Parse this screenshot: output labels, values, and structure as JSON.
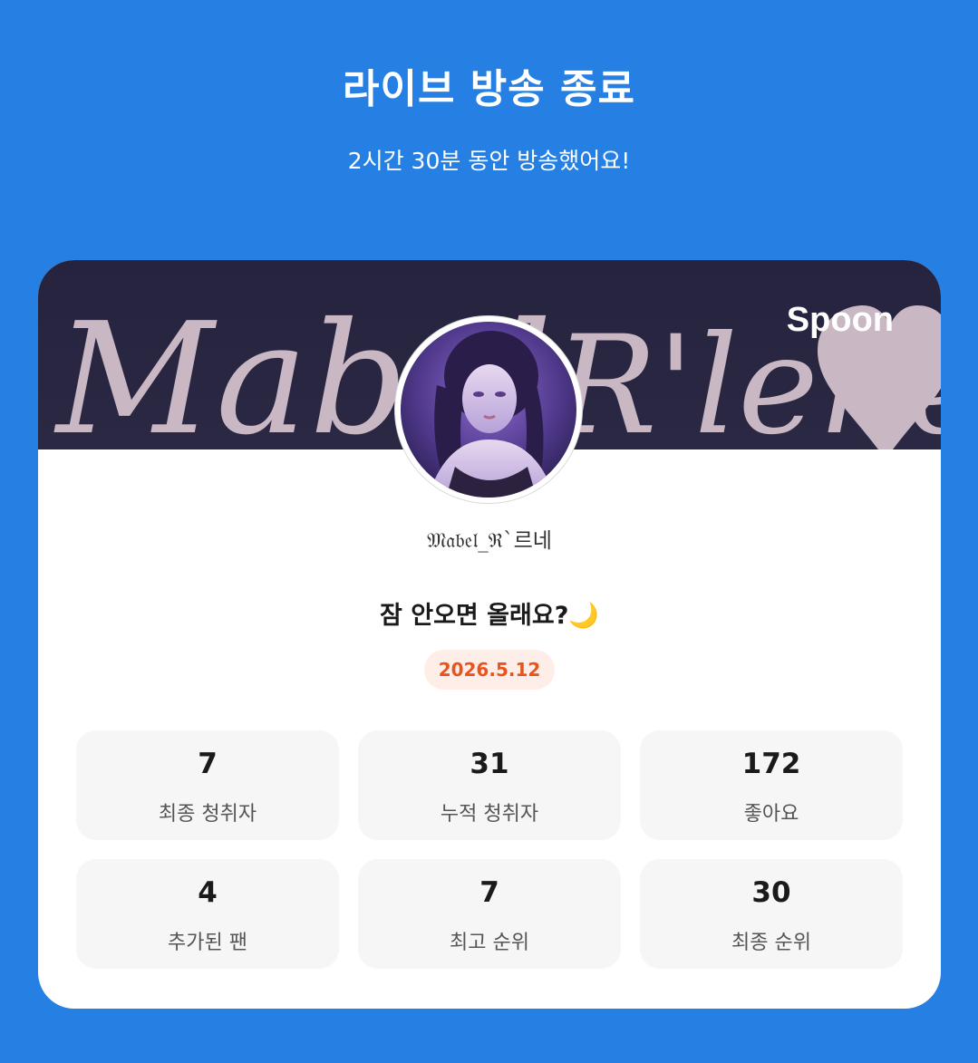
{
  "header": {
    "title": "라이브 방송 종료",
    "subtitle": "2시간 30분 동안 방송했어요!"
  },
  "banner": {
    "script_text": "Mabel_R'lene",
    "logo": "Spoon"
  },
  "profile": {
    "username": "𝔐𝔞𝔟𝔢𝔩_ℜ`르네",
    "live_title": "잠 안오면 올래요?🌙",
    "date": "2026.5.12"
  },
  "stats": [
    {
      "value": "7",
      "label": "최종 청취자"
    },
    {
      "value": "31",
      "label": "누적 청취자"
    },
    {
      "value": "172",
      "label": "좋아요"
    },
    {
      "value": "4",
      "label": "추가된 팬"
    },
    {
      "value": "7",
      "label": "최고 순위"
    },
    {
      "value": "30",
      "label": "최종 순위"
    }
  ],
  "colors": {
    "background": "#2680e3",
    "banner": "#25233d",
    "date_badge_text": "#e8541c",
    "date_badge_bg": "#ffeee8"
  }
}
